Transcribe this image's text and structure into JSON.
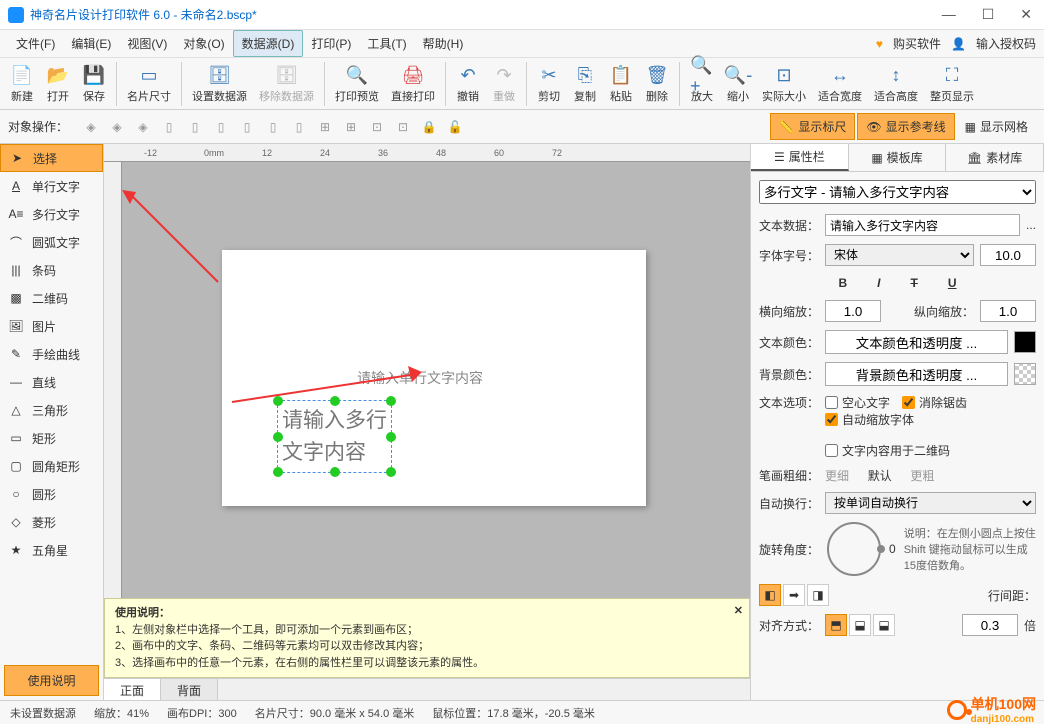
{
  "title": "神奇名片设计打印软件 6.0 - 未命名2.bscp*",
  "menu": {
    "file": "文件(F)",
    "edit": "编辑(E)",
    "view": "视图(V)",
    "object": "对象(O)",
    "datasource": "数据源(D)",
    "print": "打印(P)",
    "tools": "工具(T)",
    "help": "帮助(H)",
    "buy": "购买软件",
    "enter_code": "输入授权码"
  },
  "toolbar": {
    "new": "新建",
    "open": "打开",
    "save": "保存",
    "card_size": "名片尺寸",
    "set_ds": "设置数据源",
    "remove_ds": "移除数据源",
    "preview": "打印预览",
    "direct_print": "直接打印",
    "undo": "撤销",
    "redo": "重做",
    "cut": "剪切",
    "copy": "复制",
    "paste": "粘贴",
    "delete": "删除",
    "zoom_in": "放大",
    "zoom_out": "缩小",
    "actual": "实际大小",
    "fit_w": "适合宽度",
    "fit_h": "适合高度",
    "fit_page": "整页显示"
  },
  "objbar": {
    "label": "对象操作：",
    "show_ruler": "显示标尺",
    "show_guide": "显示参考线",
    "show_grid": "显示网格"
  },
  "tools": {
    "select": "选择",
    "single_text": "单行文字",
    "multi_text": "多行文字",
    "arc_text": "圆弧文字",
    "barcode": "条码",
    "qrcode": "二维码",
    "image": "图片",
    "freehand": "手绘曲线",
    "line": "直线",
    "triangle": "三角形",
    "rect": "矩形",
    "round_rect": "圆角矩形",
    "circle": "圆形",
    "diamond": "菱形",
    "star": "五角星",
    "use_info": "使用说明"
  },
  "canvas": {
    "single_placeholder": "请输入单行文字内容",
    "multi_placeholder_l1": "请输入多行",
    "multi_placeholder_l2": "文字内容",
    "tab_front": "正面",
    "tab_back": "背面",
    "ruler_ticks": [
      "-12",
      "0mm",
      "12",
      "24",
      "36",
      "48",
      "60",
      "72"
    ]
  },
  "help": {
    "title": "使用说明：",
    "l1": "1、左侧对象栏中选择一个工具，即可添加一个元素到画布区；",
    "l2": "2、画布中的文字、条码、二维码等元素均可以双击修改其内容；",
    "l3": "3、选择画布中的任意一个元素，在右侧的属性栏里可以调整该元素的属性。"
  },
  "rpanel": {
    "tabs": {
      "props": "属性栏",
      "templates": "模板库",
      "assets": "素材库"
    },
    "object_desc": "多行文字 - 请输入多行文字内容",
    "text_data": "文本数据：",
    "text_data_val": "请输入多行文字内容",
    "font": "字体字号：",
    "font_val": "宋体",
    "font_size": "10.0",
    "bold": "B",
    "italic": "I",
    "strike": "T",
    "under": "U",
    "hscale": "横向缩放：",
    "hscale_val": "1.0",
    "vscale": "纵向缩放：",
    "vscale_val": "1.0",
    "text_color": "文本颜色：",
    "text_color_btn": "文本颜色和透明度 ...",
    "bg_color": "背景颜色：",
    "bg_color_btn": "背景颜色和透明度 ...",
    "text_opts": "文本选项：",
    "hollow": "空心文字",
    "antialias": "消除锯齿",
    "autoscale_font": "自动缩放字体",
    "qr_content": "文字内容用于二维码",
    "stroke": "笔画粗细：",
    "thin": "更细",
    "default": "默认",
    "thick": "更粗",
    "wrap": "自动换行：",
    "wrap_val": "按单词自动换行",
    "rotate": "旋转角度：",
    "rotate_val": "0",
    "rotate_desc": "说明：在左侧小圆点上按住 Shift 键拖动鼠标可以生成15度倍数角。",
    "line_space": "行间距：",
    "line_space_val": "0.3",
    "line_unit": "倍",
    "align": "对齐方式："
  },
  "status": {
    "ds": "未设置数据源",
    "zoom": "缩放：41%",
    "dpi": "画布DPI：300",
    "size": "名片尺寸：90.0 毫米 x 54.0 毫米",
    "pos": "鼠标位置：17.8 毫米，-20.5 毫米"
  },
  "watermark": {
    "text": "单机100网",
    "url": "danji100.com"
  }
}
